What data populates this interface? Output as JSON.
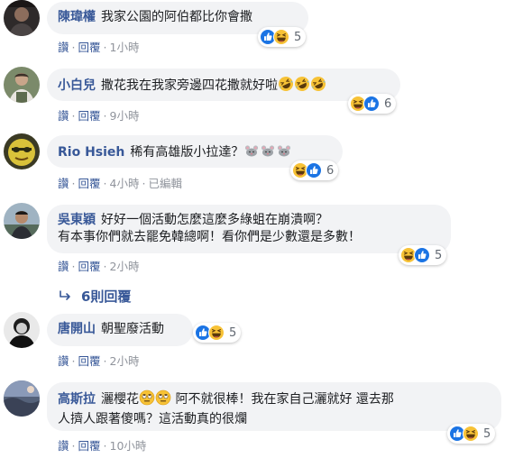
{
  "comments": [
    {
      "author": "陳瑋權",
      "text": "我家公園的阿伯都比你會撒",
      "like": "讚",
      "reply": "回覆",
      "time": "1小時",
      "reaction_count": "5",
      "reaction_icons": [
        "like-icon",
        "haha-icon"
      ]
    },
    {
      "author": "小白兒",
      "text": "撒花我在我家旁邊四花撒就好啦",
      "inline_emojis": [
        "rofl-emoji",
        "rofl-emoji",
        "rofl-emoji"
      ],
      "like": "讚",
      "reply": "回覆",
      "time": "9小時",
      "reaction_count": "6",
      "reaction_icons": [
        "haha-icon",
        "like-icon"
      ]
    },
    {
      "author": "Rio Hsieh",
      "text": "稀有高雄版小拉達？",
      "inline_emojis": [
        "mouse-emoji",
        "mouse-emoji",
        "mouse-emoji"
      ],
      "like": "讚",
      "reply": "回覆",
      "time": "4小時",
      "edited": "已編輯",
      "reaction_count": "6",
      "reaction_icons": [
        "haha-icon",
        "like-icon"
      ]
    },
    {
      "author": "吳東穎",
      "text": "好好一個活動怎麼這麼多綠蛆在崩潰啊？",
      "text2": "有本事你們就去罷免韓總啊！看你們是少數還是多數！",
      "like": "讚",
      "reply": "回覆",
      "time": "2小時",
      "reaction_count": "5",
      "reaction_icons": [
        "haha-icon",
        "like-icon"
      ]
    },
    {
      "author": "唐開山",
      "text": "朝聖廢活動",
      "like": "讚",
      "reply": "回覆",
      "time": "2小時",
      "reaction_count": "5",
      "reaction_icons": [
        "like-icon",
        "haha-icon"
      ]
    },
    {
      "author": "高斯拉",
      "text_a": "灑櫻花",
      "inline_emojis": [
        "eyeroll-emoji",
        "eyeroll-emoji"
      ],
      "text_b": "阿不就很棒！我在家自己灑就好 還去那",
      "text2": "人擠人跟著傻嗎？這活動真的很爛",
      "like": "讚",
      "reply": "回覆",
      "time": "10小時",
      "reaction_count": "5",
      "reaction_icons": [
        "like-icon",
        "haha-icon"
      ]
    }
  ],
  "view_replies": "6則回覆",
  "separator": "·",
  "colors": {
    "author": "#385898",
    "bubble": "#f2f3f5",
    "like_blue": "#1877f2",
    "haha_yellow": "#f7b125",
    "meta_gray": "#90949c"
  }
}
